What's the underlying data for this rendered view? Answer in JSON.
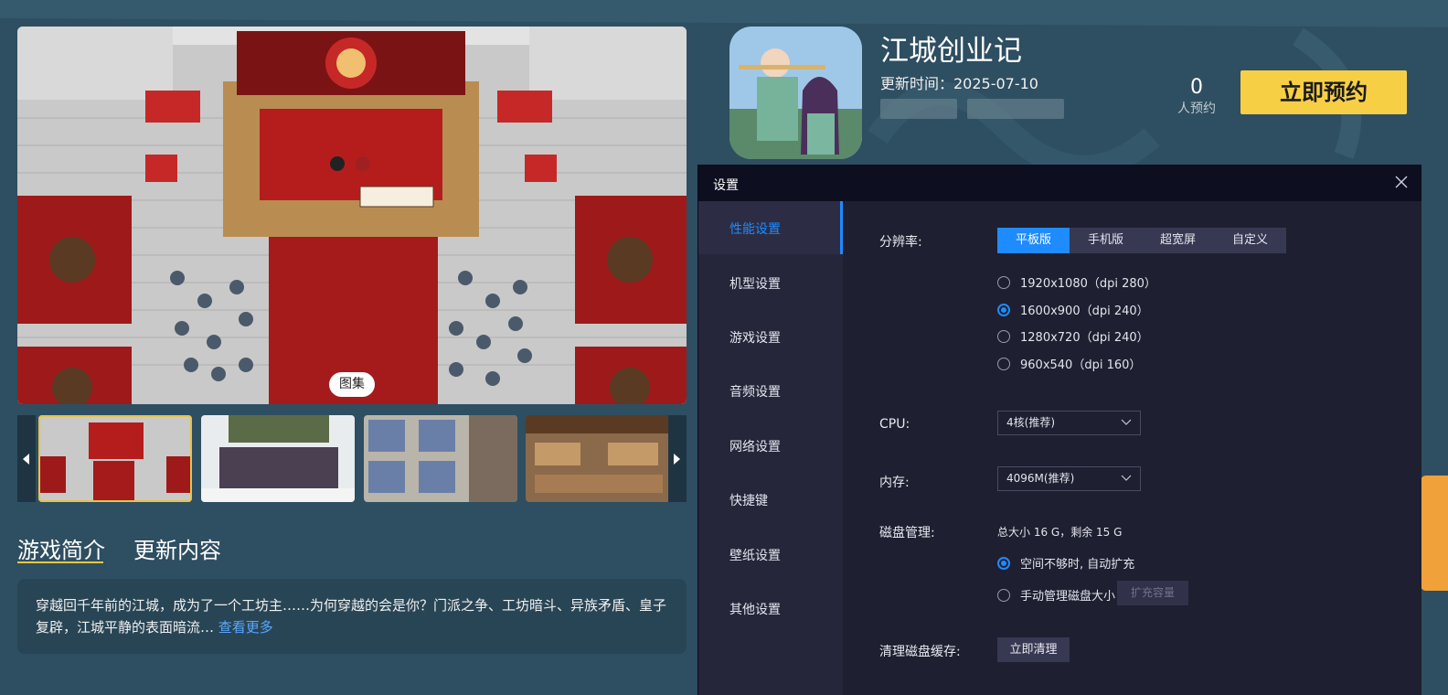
{
  "gallery": {
    "label": "图集"
  },
  "tabs": [
    {
      "label": "游戏简介"
    },
    {
      "label": "更新内容"
    }
  ],
  "intro": {
    "text": "穿越回千年前的江城，成为了一个工坊主……为何穿越的会是你？门派之争、工坊暗斗、异族矛盾、皇子复辟，江城平静的表面暗流…",
    "more": "查看更多"
  },
  "app": {
    "title": "江城创业记",
    "update_time": "更新时间：2025-07-10",
    "reserve_count": "0",
    "reserve_label": "人预约",
    "reserve_button": "立即预约"
  },
  "settings": {
    "title": "设置",
    "menu": [
      {
        "label": "性能设置"
      },
      {
        "label": "机型设置"
      },
      {
        "label": "游戏设置"
      },
      {
        "label": "音频设置"
      },
      {
        "label": "网络设置"
      },
      {
        "label": "快捷键"
      },
      {
        "label": "壁纸设置"
      },
      {
        "label": "其他设置"
      }
    ],
    "resolution_label": "分辨率:",
    "resolution_modes": [
      "平板版",
      "手机版",
      "超宽屏",
      "自定义"
    ],
    "resolution_options": [
      "1920x1080（dpi 280）",
      "1600x900（dpi 240）",
      "1280x720（dpi 240）",
      "960x540（dpi 160）"
    ],
    "cpu_label": "CPU:",
    "cpu_value": "4核(推荐)",
    "memory_label": "内存:",
    "memory_value": "4096M(推荐)",
    "disk_label": "磁盘管理:",
    "disk_info": "总大小 16 G，剩余 15 G",
    "disk_auto": "空间不够时, 自动扩充",
    "disk_manual": "手动管理磁盘大小",
    "disk_expand_button": "扩充容量",
    "cache_label": "清理磁盘缓存:",
    "cache_button": "立即清理"
  },
  "colors": {
    "accent": "#1e8bff",
    "reserve_button": "#f7cf45",
    "dialog_bg": "#1e1f30"
  }
}
